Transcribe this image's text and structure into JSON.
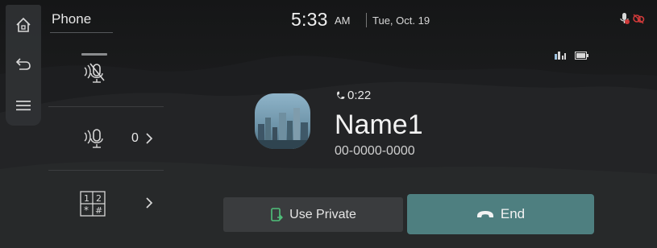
{
  "header": {
    "title": "Phone",
    "time": "5:33",
    "ampm": "AM",
    "date": "Tue, Oct. 19"
  },
  "rail": {
    "items": [
      {
        "icon": "home-icon"
      },
      {
        "icon": "back-icon"
      },
      {
        "icon": "menu-icon"
      }
    ]
  },
  "options": {
    "mute_icon": "microphone-muted-icon",
    "voice_icon": "microphone-volume-icon",
    "voice_count": "0",
    "keypad_icon": "keypad-icon"
  },
  "status_icons": [
    "microphone-off-icon",
    "voice-disabled-icon",
    "signal-icon",
    "battery-icon"
  ],
  "call": {
    "timer": "0:22",
    "name": "Name1",
    "number": "00-0000-0000"
  },
  "buttons": {
    "use_private": "Use Private",
    "end": "End"
  },
  "colors": {
    "end_button": "#4e7f80",
    "private_button": "#3a3c3e",
    "rail_bg": "#303234",
    "accent_red": "#d03a3a"
  }
}
